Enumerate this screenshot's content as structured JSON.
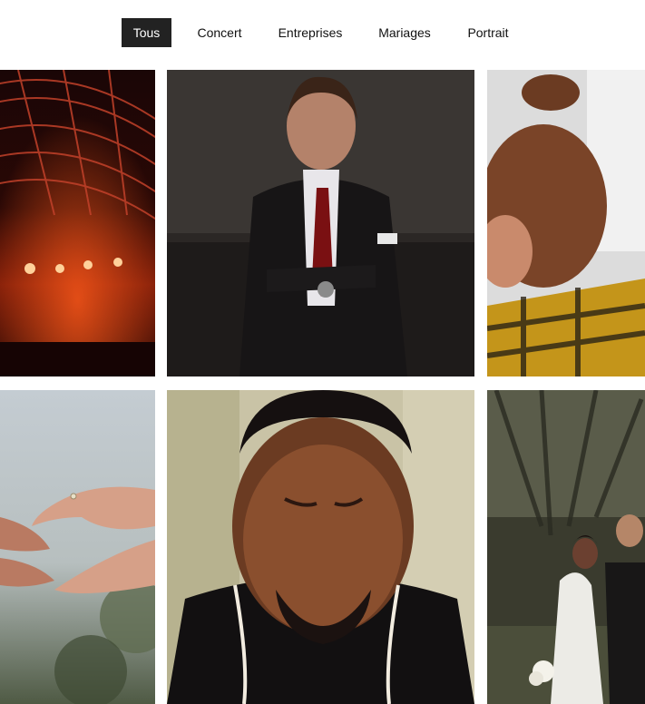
{
  "filters": {
    "items": [
      {
        "label": "Tous",
        "active": true
      },
      {
        "label": "Concert",
        "active": false
      },
      {
        "label": "Entreprises",
        "active": false
      },
      {
        "label": "Mariages",
        "active": false
      },
      {
        "label": "Portrait",
        "active": false
      }
    ]
  },
  "colors": {
    "active_bg": "#222222",
    "active_text": "#ffffff",
    "text": "#111111",
    "page_bg": "#ffffff"
  }
}
